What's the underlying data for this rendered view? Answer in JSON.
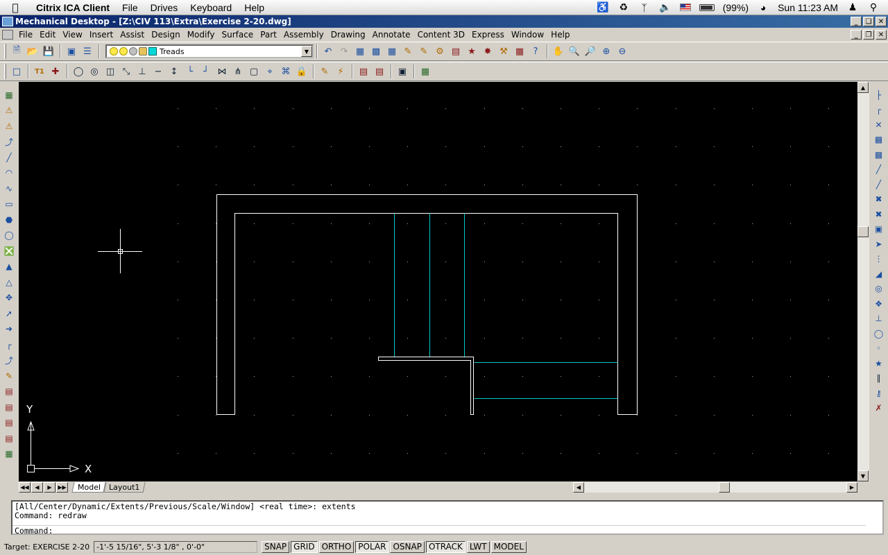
{
  "mac_menu": {
    "app_name": "Citrix ICA Client",
    "items": [
      "File",
      "Drives",
      "Keyboard",
      "Help"
    ],
    "battery": "(99%)",
    "clock": "Sun 11:23 AM"
  },
  "window": {
    "title": "Mechanical Desktop - [Z:\\CIV 113\\Extra\\Exercise 2-20.dwg]"
  },
  "menu": {
    "items": [
      "File",
      "Edit",
      "View",
      "Insert",
      "Assist",
      "Design",
      "Modify",
      "Surface",
      "Part",
      "Assembly",
      "Drawing",
      "Annotate",
      "Content 3D",
      "Express",
      "Window",
      "Help"
    ]
  },
  "layer": {
    "current": "Treads"
  },
  "ucs": {
    "x_label": "X",
    "y_label": "Y"
  },
  "tabs": {
    "model": "Model",
    "layout1": "Layout1"
  },
  "command": {
    "lines": [
      "[All/Center/Dynamic/Extents/Previous/Scale/Window] <real time>: extents",
      "Command: redraw"
    ],
    "prompt": "Command:"
  },
  "status": {
    "target": "Target: EXERCISE 2-20",
    "coords": "-1'-5 15/16\", 5'-3 1/8\" , 0'-0\"",
    "buttons": [
      {
        "label": "SNAP",
        "on": false
      },
      {
        "label": "GRID",
        "on": true
      },
      {
        "label": "ORTHO",
        "on": false
      },
      {
        "label": "POLAR",
        "on": true
      },
      {
        "label": "OSNAP",
        "on": false
      },
      {
        "label": "OTRACK",
        "on": true
      },
      {
        "label": "LWT",
        "on": false
      },
      {
        "label": "MODEL",
        "on": false
      }
    ]
  },
  "colors": {
    "canvas_bg": "#000000",
    "wall_line": "#ffffff",
    "tread_line": "#00c8c8",
    "title_bar": "#0a246a"
  }
}
